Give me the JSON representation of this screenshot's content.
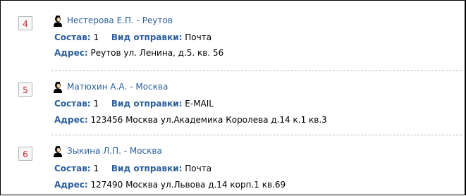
{
  "labels": {
    "composition": "Состав:",
    "shipping": "Вид отправки:",
    "address": "Адрес:"
  },
  "entries": [
    {
      "number": "4",
      "title": "Нестерова Е.П. - Реутов",
      "composition": "1",
      "shipping": "Почта",
      "address": "Реутов ул. Ленина, д.5. кв. 56"
    },
    {
      "number": "5",
      "title": "Матюхин А.А. - Москва",
      "composition": "1",
      "shipping": "E-MAIL",
      "address": "123456 Москва ул.Академика Королева д.14 к.1 кв.3"
    },
    {
      "number": "6",
      "title": "Зыкина Л.П. - Москва",
      "composition": "1",
      "shipping": "Почта",
      "address": "127490 Москва ул.Львова д.14 корп.1 кв.69"
    }
  ],
  "colors": {
    "label": "#2b5e9c",
    "number": "#c0282e",
    "separator": "#b9b9b9"
  },
  "icons": {
    "person": "user-icon"
  }
}
